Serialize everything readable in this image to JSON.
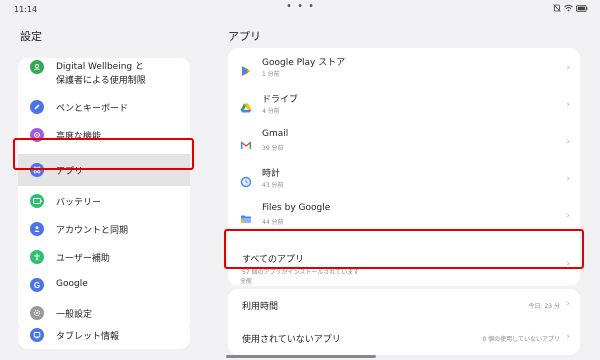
{
  "status_bar": {
    "time": "11:14"
  },
  "left_panel": {
    "title": "設定",
    "items": [
      {
        "label_line1": "Digital Wellbeing と",
        "label_line2": "保護者による使用制限",
        "icon": "wellbeing-icon",
        "color": "#34a853"
      },
      {
        "label": "ペンとキーボード",
        "icon": "pen-icon",
        "color": "#4a74e8"
      },
      {
        "label": "高度な機能",
        "icon": "advanced-icon",
        "color": "#a05cde"
      },
      {
        "label": "アプリ",
        "icon": "apps-icon",
        "color": "#4a74e8"
      },
      {
        "label": "バッテリー",
        "icon": "battery-icon",
        "color": "#2fbf71"
      },
      {
        "label": "アカウントと同期",
        "icon": "account-icon",
        "color": "#4a74e8"
      },
      {
        "label": "ユーザー補助",
        "icon": "accessibility-icon",
        "color": "#2fbf71"
      },
      {
        "label": "Google",
        "icon": "google-icon",
        "color": "#4a74e8"
      },
      {
        "label": "一般設定",
        "icon": "general-settings-icon",
        "color": "#9a9a9a"
      },
      {
        "label": "タブレット情報",
        "icon": "tablet-info-icon",
        "color": "#4a74e8"
      }
    ]
  },
  "right_panel": {
    "title": "アプリ",
    "recent_apps": [
      {
        "name": "Google Play ストア",
        "time": "1 分前",
        "icon": "google-play-icon"
      },
      {
        "name": "ドライブ",
        "time": "4 分前",
        "icon": "drive-icon"
      },
      {
        "name": "Gmail",
        "time": "39 分前",
        "icon": "gmail-icon"
      },
      {
        "name": "時計",
        "time": "43 分前",
        "icon": "clock-icon"
      },
      {
        "name": "Files by Google",
        "time": "44 分前",
        "icon": "files-icon"
      }
    ],
    "all_apps": {
      "label": "すべてのアプリ",
      "subtitle": "57 個のアプリがインストールされています"
    },
    "section_label": "全般",
    "general": [
      {
        "label": "利用時間",
        "value": "今日: 23 分"
      },
      {
        "label": "使用されていないアプリ",
        "value": "0 個の使用していないアプリ"
      }
    ]
  }
}
